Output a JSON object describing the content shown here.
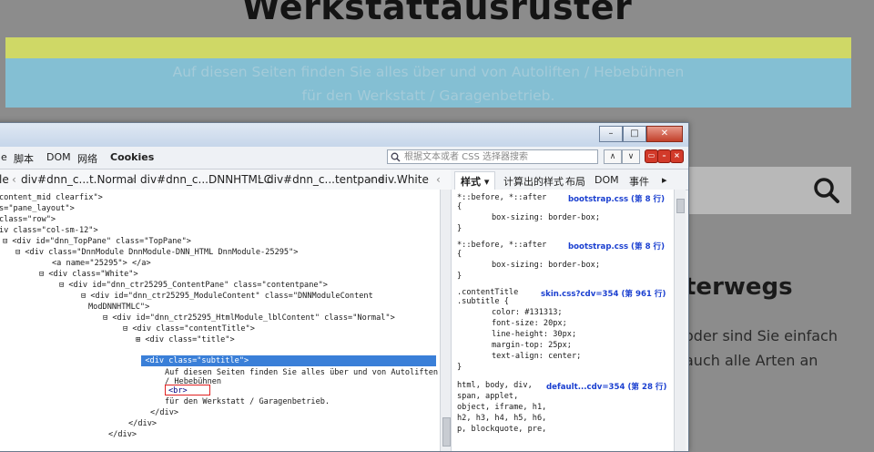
{
  "site": {
    "title": "Werkstattausrüster",
    "tagline_line1": "Auf diesen Seiten finden Sie alles über und von Autoliften / Hebebühnen",
    "tagline_line2": "für den Werkstatt / Garagenbetrieb.",
    "heading_partial": "terwegs",
    "body_line1": "oder sind Sie einfach",
    "body_line2": "auch alle Arten an",
    "search_icon": "search-icon"
  },
  "devtools": {
    "menu": [
      "e",
      "脚本",
      "DOM",
      "网络",
      "Cookies"
    ],
    "search_placeholder": "根据文本或者 CSS 选择器搜索",
    "nav_up": "∧",
    "nav_down": "∨",
    "breadcrumb": [
      "le",
      "div#dnn_c...t.Normal",
      "div#dnn_c...DNNHTMLC",
      "div#dnn_c...tentpane",
      "div.White",
      "‹"
    ],
    "side_tabs": [
      "样式 ▾",
      "计算出的样式",
      "布局",
      "DOM",
      "事件",
      "▸"
    ],
    "html_lines": [
      "content_mid clearfix\">",
      "s=\"pane_layout\">",
      "class=\"row\">",
      "iv  class=\"col-sm-12\">",
      "⊟ <div  id=\"dnn_TopPane\"  class=\"TopPane\">",
      "⊟ <div  class=\"DnnModule DnnModule-DNN_HTML DnnModule-25295\">",
      "<a  name=\"25295\"> </a>",
      "⊟ <div  class=\"White\">",
      "⊟ <div  id=\"dnn_ctr25295_ContentPane\"  class=\"contentpane\">",
      "⊟ <div  id=\"dnn_ctr25295_ModuleContent\"  class=\"DNNModuleContent",
      "ModDNNHTMLC\">",
      "⊟ <div  id=\"dnn_ctr25295_HtmlModule_lblContent\"  class=\"Normal\">",
      "⊟ <div  class=\"contentTitle\">",
      "⊞ <div  class=\"title\">",
      "⊟ <div  class=\"subtitle\">",
      "Auf diesen Seiten finden Sie alles über und von Autoliften",
      "/ Hebebühnen",
      "<br>",
      "für den Werkstatt / Garagenbetrieb.",
      "</div>",
      "</div>",
      "</div>"
    ],
    "css_rules": [
      {
        "selector": "*::before, *::after",
        "source": "bootstrap.css (第 8 行)",
        "decls": [
          "box-sizing: border-box;"
        ]
      },
      {
        "selector": "*::before, *::after",
        "source": "bootstrap.css (第 8 行)",
        "decls": [
          "box-sizing: border-box;"
        ]
      },
      {
        "selector": ".contentTitle",
        "selector2": ".subtitle {",
        "source": "skin.css?cdv=354 (第 961 行)",
        "decls": [
          "color: #131313;",
          "font-size: 20px;",
          "line-height: 30px;",
          "margin-top: 25px;",
          "text-align: center;"
        ]
      },
      {
        "selector": "html, body, div,",
        "source": "default...cdv=354 (第 28 行)",
        "extra": [
          "span, applet,",
          "object, iframe, h1,",
          "h2, h3, h4, h5, h6,",
          "p, blockquote, pre,"
        ]
      }
    ]
  }
}
